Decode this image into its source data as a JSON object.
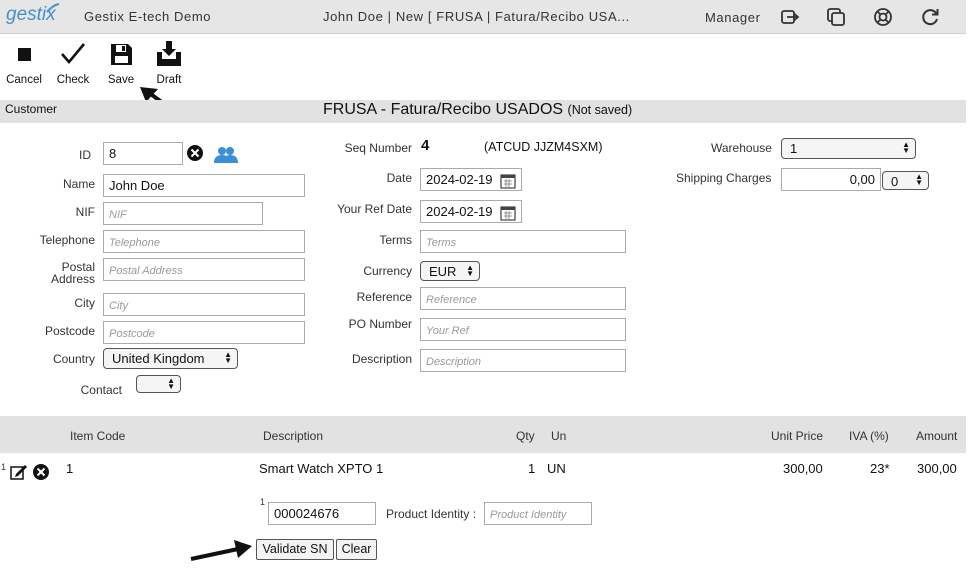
{
  "topbar": {
    "logo": "gestix",
    "app_name": "Gestix E-tech Demo",
    "window_title": "John Doe | New [ FRUSA | Fatura/Recibo USA...",
    "user": "Manager",
    "icons": [
      "logout-icon",
      "windows-icon",
      "help-lifebuoy-icon",
      "refresh-icon"
    ]
  },
  "toolbar": {
    "cancel_label": "Cancel",
    "check_label": "Check",
    "save_label": "Save",
    "draft_label": "Draft"
  },
  "section": {
    "customer_label": "Customer",
    "doc_title": "FRUSA - Fatura/Recibo USADOS",
    "doc_status": "(Not saved)"
  },
  "customer": {
    "id_label": "ID",
    "id_value": "8",
    "name_label": "Name",
    "name_value": "John Doe",
    "nif_label": "NIF",
    "nif_placeholder": "NIF",
    "telephone_label": "Telephone",
    "telephone_placeholder": "Telephone",
    "postal_label_1": "Postal",
    "postal_label_2": "Address",
    "postal_placeholder": "Postal Address",
    "city_label": "City",
    "city_placeholder": "City",
    "postcode_label": "Postcode",
    "postcode_placeholder": "Postcode",
    "country_label": "Country",
    "country_value": "United Kingdom",
    "contact_label": "Contact",
    "contact_value": ""
  },
  "document": {
    "seq_label": "Seq Number",
    "seq_value": "4",
    "atcud": "(ATCUD JJZM4SXM)",
    "date_label": "Date",
    "date_value": "2024-02-19",
    "yourref_date_label": "Your Ref Date",
    "yourref_date_value": "2024-02-19",
    "terms_label": "Terms",
    "terms_placeholder": "Terms",
    "currency_label": "Currency",
    "currency_value": "EUR",
    "reference_label": "Reference",
    "reference_placeholder": "Reference",
    "po_label": "PO Number",
    "po_placeholder": "Your Ref",
    "description_label": "Description",
    "description_placeholder": "Description"
  },
  "warehouse": {
    "warehouse_label": "Warehouse",
    "warehouse_value": "1",
    "shipping_label": "Shipping Charges",
    "shipping_value": "0,00",
    "shipping_select": "0"
  },
  "grid": {
    "headers": {
      "item_code": "Item Code",
      "description": "Description",
      "qty": "Qty",
      "un": "Un",
      "unit_price": "Unit Price",
      "iva": "IVA (%)",
      "amount": "Amount"
    },
    "rows": [
      {
        "line": "1",
        "item_code": "1",
        "description": "Smart Watch XPTO 1",
        "qty": "1",
        "un": "UN",
        "unit_price": "300,00",
        "iva": "23*",
        "amount": "300,00"
      }
    ]
  },
  "serial": {
    "index": "1",
    "serial_value": "000024676",
    "product_identity_label": "Product Identity :",
    "product_identity_placeholder": "Product Identity",
    "validate_label": "Validate SN",
    "clear_label": "Clear"
  }
}
